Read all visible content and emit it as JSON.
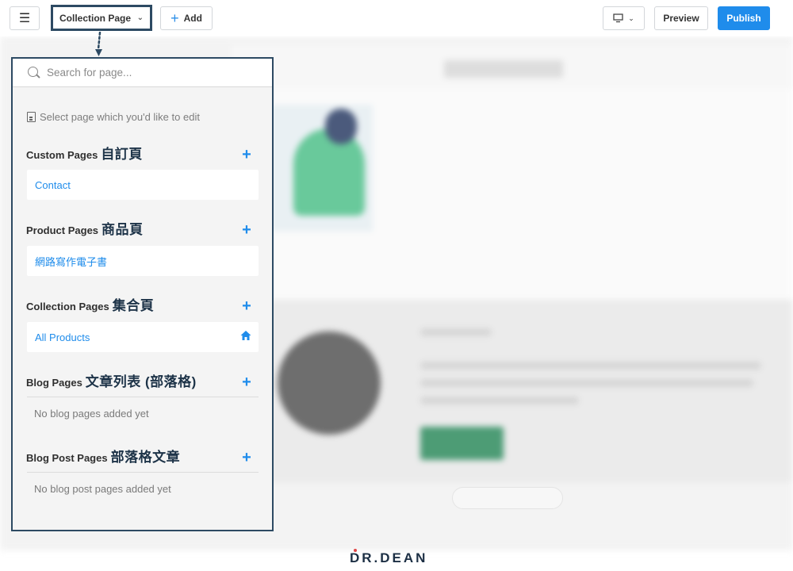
{
  "toolbar": {
    "menu_icon": "menu-icon",
    "page_select_label": "Collection Page",
    "add_label": "Add",
    "preview_label": "Preview",
    "publish_label": "Publish",
    "device_icon": "desktop-icon"
  },
  "panel": {
    "search_placeholder": "Search for page...",
    "hint": "Select page which you'd like to edit",
    "sections": {
      "custom": {
        "title": "Custom Pages",
        "title_zh": "自訂頁",
        "items": [
          "Contact"
        ]
      },
      "product": {
        "title": "Product Pages",
        "title_zh": "商品頁",
        "items": [
          "網路寫作電子書"
        ]
      },
      "collection": {
        "title": "Collection Pages",
        "title_zh": "集合頁",
        "items": [
          "All Products"
        ]
      },
      "blog": {
        "title": "Blog Pages",
        "title_zh": "文章列表 (部落格)",
        "empty": "No blog pages added yet"
      },
      "blog_post": {
        "title": "Blog Post Pages",
        "title_zh": "部落格文章",
        "empty": "No blog post pages added yet"
      }
    }
  },
  "brand": "R.DEAN",
  "colors": {
    "accent": "#1f8ceb",
    "frame": "#2d4a63",
    "brand_dot": "#e04848"
  }
}
